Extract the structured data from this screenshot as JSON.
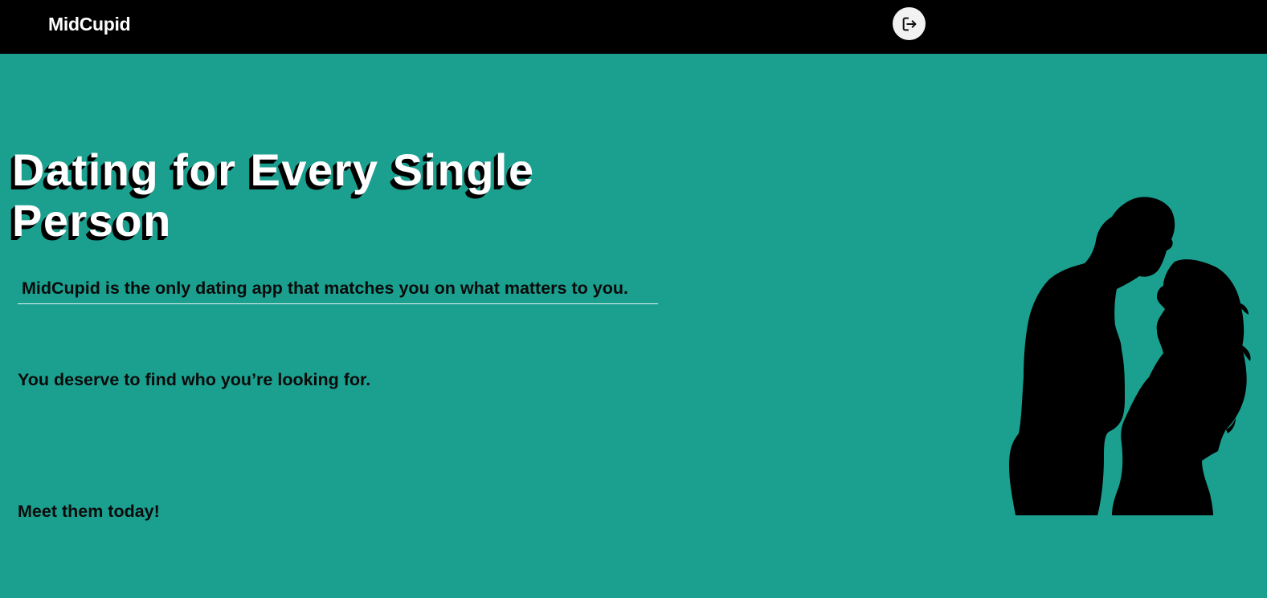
{
  "header": {
    "brand": "MidCupid",
    "logout_icon": "logout-icon"
  },
  "hero": {
    "title": "Dating for Every Single Person",
    "tagline": "MidCupid is the only dating app that matches you on what matters to you.",
    "line2": "You deserve to find who you’re looking for.",
    "line3": "Meet them today!",
    "image": "couple-silhouette"
  },
  "colors": {
    "header_bg": "#000000",
    "page_bg": "#1ba090",
    "title_text": "#ffffff",
    "body_text": "#0a0a0a"
  }
}
